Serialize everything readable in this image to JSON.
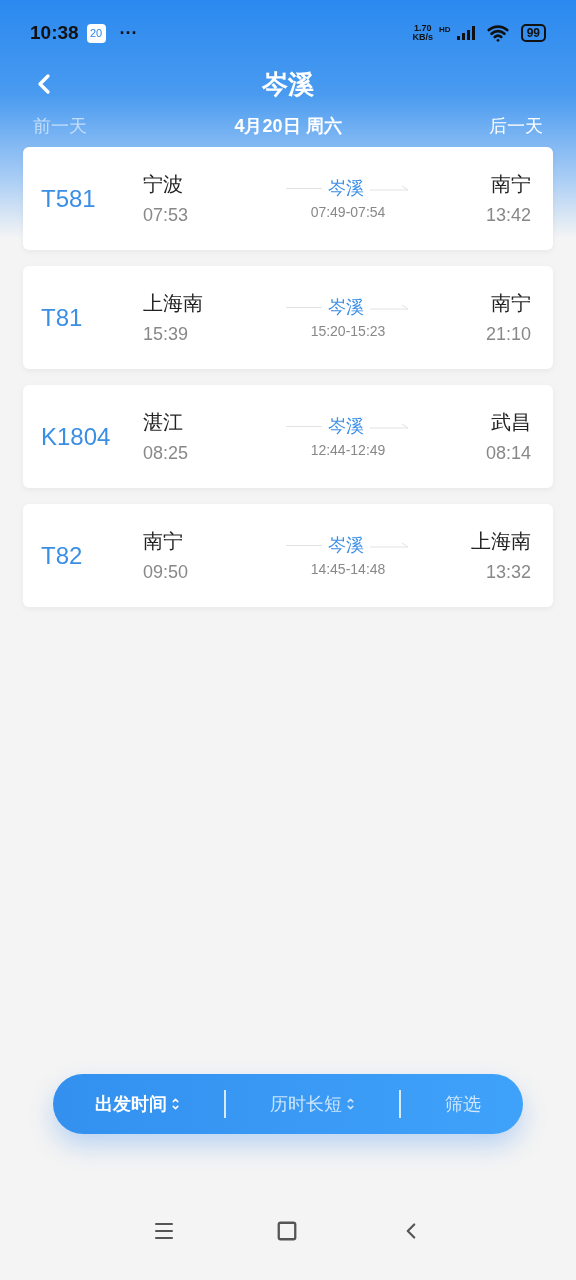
{
  "status_bar": {
    "time": "10:38",
    "calendar_day": "20",
    "more": "···",
    "net_speed": "1.70",
    "net_unit": "KB/s",
    "network_tag": "HD",
    "battery": "99"
  },
  "header": {
    "title": "岑溪"
  },
  "date_nav": {
    "prev": {
      "label": "前一天",
      "disabled": true
    },
    "date": "4月20日 周六",
    "next": {
      "label": "后一天",
      "disabled": false
    }
  },
  "trains": [
    {
      "number": "T581",
      "from": "宁波",
      "depart": "07:53",
      "via": "岑溪",
      "stop_time": "07:49-07:54",
      "to": "南宁",
      "arrive": "13:42"
    },
    {
      "number": "T81",
      "from": "上海南",
      "depart": "15:39",
      "via": "岑溪",
      "stop_time": "15:20-15:23",
      "to": "南宁",
      "arrive": "21:10"
    },
    {
      "number": "K1804",
      "from": "湛江",
      "depart": "08:25",
      "via": "岑溪",
      "stop_time": "12:44-12:49",
      "to": "武昌",
      "arrive": "08:14"
    },
    {
      "number": "T82",
      "from": "南宁",
      "depart": "09:50",
      "via": "岑溪",
      "stop_time": "14:45-14:48",
      "to": "上海南",
      "arrive": "13:32"
    }
  ],
  "sort_bar": [
    {
      "kind": "sort",
      "label": "出发时间",
      "selected": true
    },
    {
      "kind": "sort",
      "label": "历时长短",
      "selected": false
    },
    {
      "kind": "filter",
      "label": "筛选",
      "selected": false
    }
  ]
}
